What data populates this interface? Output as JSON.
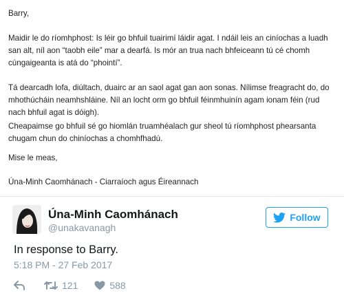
{
  "letter": {
    "greeting": "Barry,",
    "para1": "Maidir le do ríomhphost: Is léir go bhfuil tuairimí láidir agat. I ndáil leis an ciníochas a luadh san alt, níl aon “taobh eile” mar a dearfá. Is mór an trua nach bhfeiceann tú cé chomh cúngaigeanta is atá do “phointí”.",
    "para2": "Tá dearcadh lofa, diúltach, duairc ar an saol agat gan aon sonas. Nílimse freagracht do, do mhothúcháin neamhshláine. Níl an locht orm go bhfuil féinmhuinín agam ionam féin (rud nach bhfuil agat is dóigh).",
    "para3": "Cheapaimse go bhfuil sé go hiomlán truamhéalach gur sheol tú ríomhphost phearsanta chugam chun do chiníochas a chomhfhadú.",
    "closing": "Mise le meas,",
    "signature": "Úna-Minh Caomhánach - Ciarraíoch agus Éireannach"
  },
  "tweet": {
    "display_name": "Úna-Minh Caomhánach",
    "handle": "@unakavanagh",
    "follow_label": "Follow",
    "text": "In response to Barry.",
    "timestamp": "5:18 PM - 27 Feb 2017",
    "retweets": "121",
    "likes": "588"
  },
  "colors": {
    "brand_blue": "#1da1f2",
    "muted_gray": "#8899a6",
    "text": "#14171a"
  },
  "icons": [
    "reply-icon",
    "retweet-icon",
    "like-icon",
    "twitter-bird-icon",
    "avatar"
  ]
}
